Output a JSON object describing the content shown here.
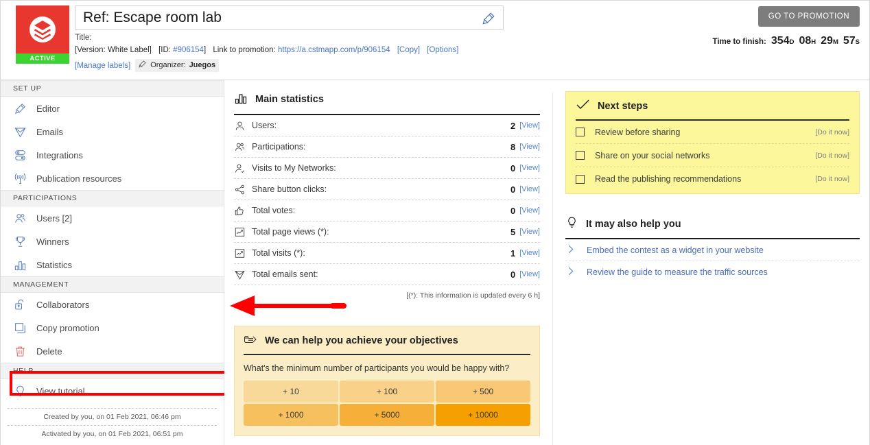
{
  "header": {
    "logo_badge": "ACTIVE",
    "logo_icon": "stacked-layers-icon",
    "title_value": "Ref: Escape room lab",
    "title_placeholder": "Ref:",
    "title_label": "Title:",
    "edit_icon": "pencil-icon",
    "meta": {
      "version": "[Version: White Label]",
      "id_prefix": "[ID: ",
      "id_value": "#906154",
      "id_suffix": "]",
      "link_label": "Link to promotion:",
      "link_url": "https://a.cstmapp.com/p/906154",
      "copy": "[Copy]",
      "options": "[Options]",
      "manage_labels": "[Manage labels]",
      "organizer_label": "Organizer:",
      "organizer_name": "Juegos",
      "organizer_icon": "pencil-icon"
    },
    "goto_button": "GO TO PROMOTION",
    "timer": {
      "label": "Time to finish:",
      "days": "354",
      "days_unit": "D",
      "hours": "08",
      "hours_unit": "H",
      "minutes": "29",
      "minutes_unit": "M",
      "seconds": "57",
      "seconds_unit": "S"
    }
  },
  "sidebar": {
    "sections": [
      {
        "title": "SET UP",
        "items": [
          {
            "label": "Editor",
            "icon": "pencil-icon"
          },
          {
            "label": "Emails",
            "icon": "paper-plane-icon"
          },
          {
            "label": "Integrations",
            "icon": "server-stack-icon"
          },
          {
            "label": "Publication resources",
            "icon": "broadcast-antenna-icon"
          }
        ]
      },
      {
        "title": "PARTICIPATIONS",
        "items": [
          {
            "label": "Users [2]",
            "icon": "users-group-icon"
          },
          {
            "label": "Winners",
            "icon": "trophy-icon"
          },
          {
            "label": "Statistics",
            "icon": "bar-chart-icon"
          }
        ]
      },
      {
        "title": "MANAGEMENT",
        "items": [
          {
            "label": "Collaborators",
            "icon": "open-lock-icon",
            "highlighted": true
          },
          {
            "label": "Copy promotion",
            "icon": "copy-icon"
          },
          {
            "label": "Delete",
            "icon": "trash-icon"
          }
        ]
      },
      {
        "title": "HELP",
        "items": [
          {
            "label": "View tutorial",
            "icon": "lightbulb-icon"
          }
        ]
      }
    ],
    "footer": [
      "Created by you, on 01 Feb 2021, 06:46 pm",
      "Activated by you, on 01 Feb 2021, 06:51 pm"
    ]
  },
  "main_statistics": {
    "title": "Main statistics",
    "icon": "bar-chart-icon",
    "view_label": "[View]",
    "rows": [
      {
        "label": "Users:",
        "value": "2",
        "icon": "user-icon"
      },
      {
        "label": "Participations:",
        "value": "8",
        "icon": "users-group-icon"
      },
      {
        "label": "Visits to My Networks:",
        "value": "0",
        "icon": "user-check-icon"
      },
      {
        "label": "Share button clicks:",
        "value": "0",
        "icon": "share-icon"
      },
      {
        "label": "Total votes:",
        "value": "0",
        "icon": "thumbs-up-icon"
      },
      {
        "label": "Total page views (*):",
        "value": "5",
        "icon": "chart-line-icon"
      },
      {
        "label": "Total visits (*):",
        "value": "1",
        "icon": "chart-line-icon"
      },
      {
        "label": "Total emails sent:",
        "value": "0",
        "icon": "paper-plane-icon"
      }
    ],
    "note": "[(*): This information is updated every 6 h]"
  },
  "next_steps": {
    "title": "Next steps",
    "icon": "checkmark-icon",
    "action_label": "[Do it now]",
    "items": [
      {
        "label": "Review before sharing",
        "checked": false
      },
      {
        "label": "Share on your social networks",
        "checked": false
      },
      {
        "label": "Read the publishing recommendations",
        "checked": false
      }
    ]
  },
  "help_you": {
    "title": "It may also help you",
    "icon": "lightbulb-icon",
    "links": [
      "Embed the contest as a widget in your website",
      "Review the guide to measure the traffic sources"
    ]
  },
  "objectives": {
    "title": "We can help you achieve your objectives",
    "icon": "pointing-hand-icon",
    "question": "What's the minimum number of participants you would be happy with?",
    "options": [
      {
        "label": "+ 10",
        "color": "#f8d99a"
      },
      {
        "label": "+ 100",
        "color": "#f9d189"
      },
      {
        "label": "+ 500",
        "color": "#f8c874"
      },
      {
        "label": "+ 1000",
        "color": "#f7c05f"
      },
      {
        "label": "+ 5000",
        "color": "#f6b03a"
      },
      {
        "label": "+ 10000",
        "color": "#f5a000"
      }
    ]
  },
  "annotation": {
    "arrow_color": "#fe0000",
    "highlight_color": "#fe0000",
    "highlight_target": "Collaborators"
  }
}
